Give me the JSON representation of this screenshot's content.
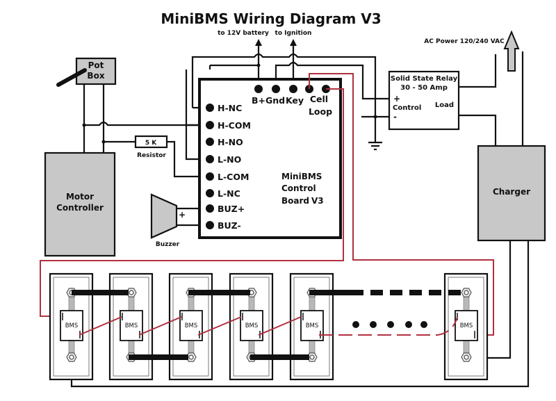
{
  "title": "MiniBMS Wiring Diagram V3",
  "labels": {
    "to_battery": "to 12V battery",
    "to_ignition": "to Ignition",
    "ac_power": "AC Power 120/240 VAC",
    "resistor_value": "5 K",
    "resistor_label": "Resistor",
    "buzzer_label": "Buzzer",
    "buzzer_plus": "+"
  },
  "pot_box": {
    "line1": "Pot",
    "line2": "Box"
  },
  "motor_controller": {
    "line1": "Motor",
    "line2": "Controller"
  },
  "charger": {
    "label": "Charger"
  },
  "relay": {
    "line1": "Solid State Relay",
    "line2": "30 - 50 Amp",
    "plus": "+",
    "control": "Control",
    "minus": "-",
    "load": "Load"
  },
  "board": {
    "name_line1": "MiniBMS",
    "name_line2": "Control",
    "name_line3": "Board",
    "version": "V3",
    "side_pins": [
      "H-NC",
      "H-COM",
      "H-NO",
      "L-NO",
      "L-COM",
      "L-NC",
      "BUZ+",
      "BUZ-"
    ],
    "top_pins": [
      "B+",
      "Gnd",
      "Key",
      "Cell",
      "Loop"
    ]
  },
  "cells": {
    "module_label": "BMS",
    "count_shown": 6
  },
  "colors": {
    "wire": "#111111",
    "cell_loop": "#b0303f",
    "component_fill": "#c8c8c8"
  }
}
